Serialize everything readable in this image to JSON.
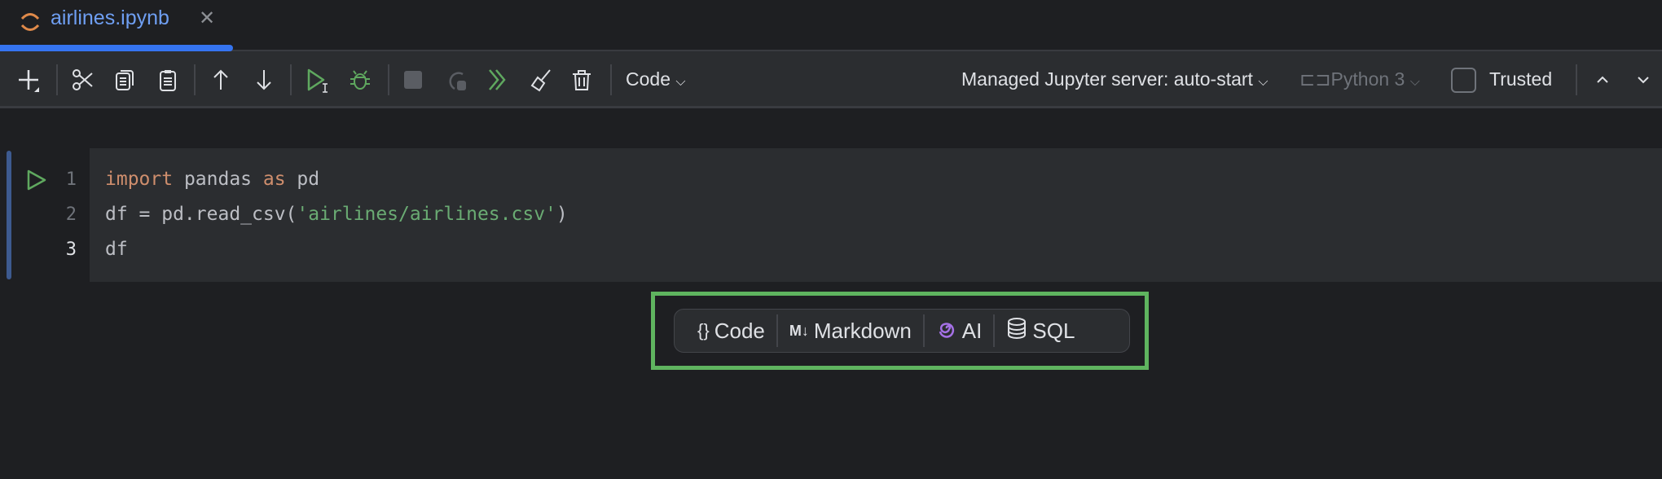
{
  "tab": {
    "title": "airlines.ipynb",
    "icon": "jupyter-icon"
  },
  "toolbar": {
    "cell_type": "Code",
    "server": "Managed Jupyter server: auto-start",
    "kernel": "Python 3",
    "trusted": "Trusted"
  },
  "cell": {
    "line_numbers": [
      "1",
      "2",
      "3"
    ],
    "lines": [
      [
        {
          "t": "import",
          "c": "kw"
        },
        {
          "t": " pandas ",
          "c": ""
        },
        {
          "t": "as",
          "c": "kw"
        },
        {
          "t": " pd",
          "c": ""
        }
      ],
      [
        {
          "t": "df = pd.read_csv(",
          "c": ""
        },
        {
          "t": "'airlines/airlines.csv'",
          "c": "str"
        },
        {
          "t": ")",
          "c": ""
        }
      ],
      [
        {
          "t": "df",
          "c": ""
        }
      ]
    ]
  },
  "add_cell": {
    "code": "Code",
    "markdown": "Markdown",
    "markdown_badge": "M↓",
    "ai": "AI",
    "sql": "SQL"
  },
  "colors": {
    "accent": "#3574f0",
    "highlight": "#5fb45f",
    "run": "#5fa85f",
    "ai": "#a571e6"
  }
}
